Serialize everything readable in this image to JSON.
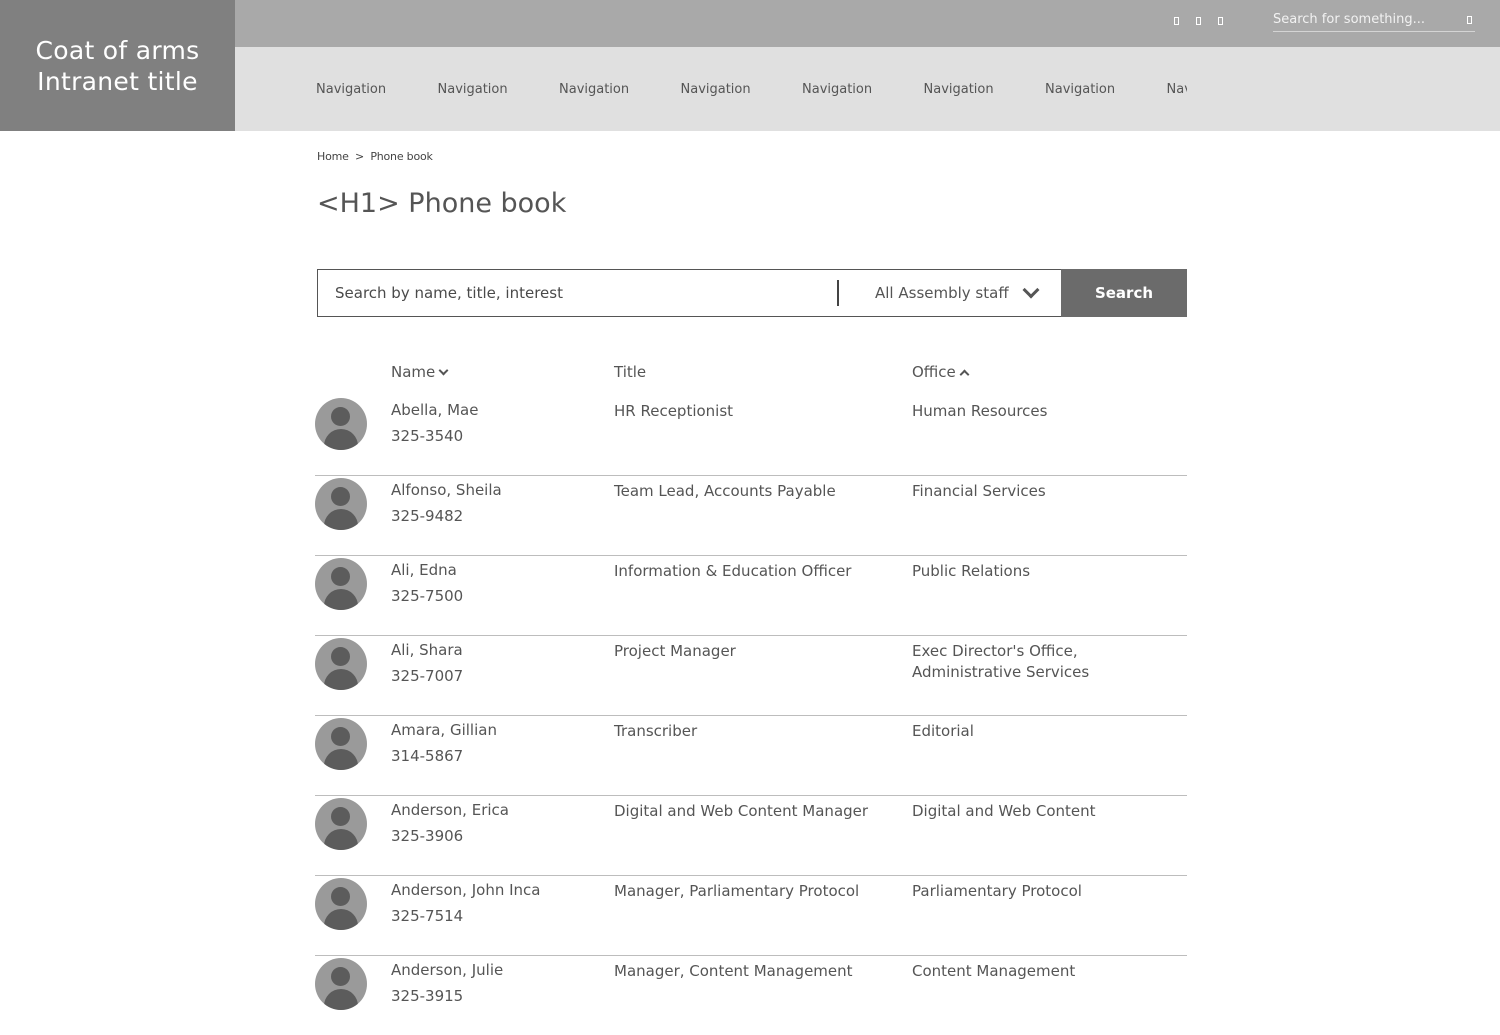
{
  "brand": {
    "line1": "Coat of arms",
    "line2": "Intranet title"
  },
  "header": {
    "search_placeholder": "Search for something..."
  },
  "nav": {
    "items": [
      "Navigation",
      "Navigation",
      "Navigation",
      "Navigation",
      "Navigation",
      "Navigation",
      "Navigation",
      "Navigation"
    ]
  },
  "breadcrumb": {
    "home": "Home",
    "separator": ">",
    "current": "Phone book"
  },
  "page": {
    "title": "<H1> Phone book"
  },
  "search": {
    "placeholder": "Search by name, title, interest",
    "filter": "All Assembly staff",
    "button": "Search"
  },
  "table": {
    "headers": {
      "name": "Name",
      "title": "Title",
      "office": "Office"
    },
    "rows": [
      {
        "name": "Abella, Mae",
        "phone": "325-3540",
        "title": "HR Receptionist",
        "office": "Human Resources"
      },
      {
        "name": "Alfonso, Sheila",
        "phone": "325-9482",
        "title": "Team Lead, Accounts Payable",
        "office": "Financial Services"
      },
      {
        "name": "Ali, Edna",
        "phone": "325-7500",
        "title": "Information & Education Officer",
        "office": "Public Relations"
      },
      {
        "name": "Ali, Shara",
        "phone": "325-7007",
        "title": "Project Manager",
        "office": "Exec Director's Office, Administrative Services"
      },
      {
        "name": "Amara, Gillian",
        "phone": "314-5867",
        "title": "Transcriber",
        "office": "Editorial"
      },
      {
        "name": "Anderson, Erica",
        "phone": "325-3906",
        "title": "Digital and Web Content Manager",
        "office": "Digital and Web Content"
      },
      {
        "name": "Anderson, John Inca",
        "phone": "325-7514",
        "title": "Manager, Parliamentary Protocol",
        "office": "Parliamentary Protocol"
      },
      {
        "name": "Anderson, Julie",
        "phone": "325-3915",
        "title": "Manager, Content Management",
        "office": "Content Management"
      }
    ]
  },
  "colors": {
    "logo_bg": "#808080",
    "topbar_bg": "#a9a9a9",
    "nav_bg": "#e0e0e0",
    "button_bg": "#6b6b6b",
    "avatar_bg": "#9a9a9a"
  }
}
